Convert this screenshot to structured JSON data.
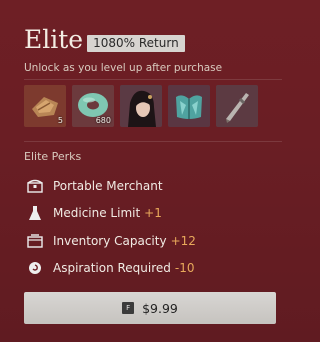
{
  "header": {
    "title": "Elite",
    "return_badge": "1080% Return",
    "subtitle": "Unlock as you level up after purchase"
  },
  "rewards": [
    {
      "icon": "wood-bundle-icon",
      "count": "5"
    },
    {
      "icon": "jade-disc-icon",
      "count": "680"
    },
    {
      "icon": "character-portrait-icon",
      "count": ""
    },
    {
      "icon": "teal-outfit-icon",
      "count": ""
    },
    {
      "icon": "weapon-blade-icon",
      "count": ""
    }
  ],
  "perks_section": {
    "label": "Elite Perks",
    "items": [
      {
        "icon": "merchant-chest-icon",
        "label": "Portable Merchant",
        "bonus": ""
      },
      {
        "icon": "medicine-flask-icon",
        "label": "Medicine Limit",
        "bonus": "+1"
      },
      {
        "icon": "inventory-box-icon",
        "label": "Inventory Capacity",
        "bonus": "+12"
      },
      {
        "icon": "aspiration-swirl-icon",
        "label": "Aspiration Required",
        "bonus": "-10"
      }
    ]
  },
  "purchase": {
    "key_hint": "F",
    "price": "$9.99"
  },
  "colors": {
    "background": "#6a1e24",
    "bonus": "#e8a95b",
    "badge": "#d7d4d0",
    "button": "#d0cdca"
  }
}
